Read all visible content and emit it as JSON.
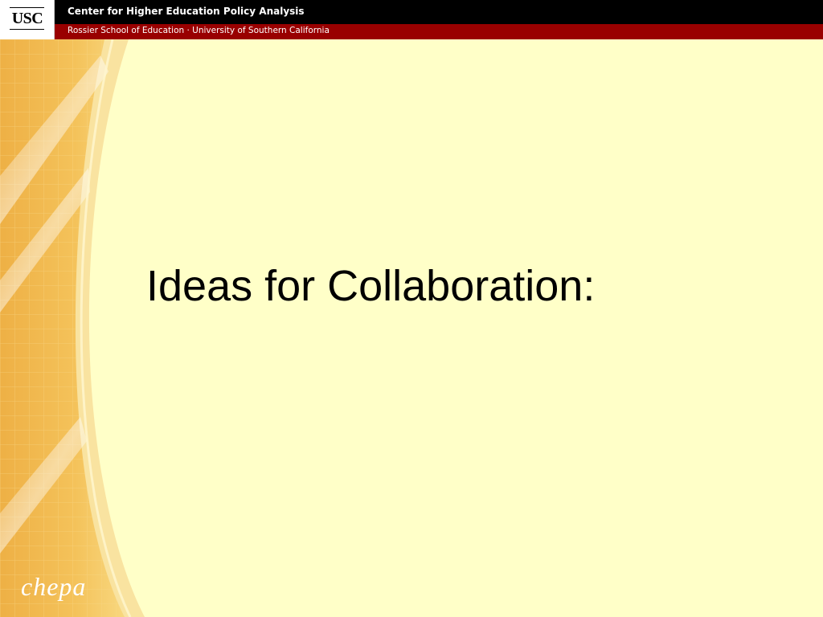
{
  "header": {
    "logo_text": "USC",
    "title": "Center for Higher Education Policy Analysis",
    "subtitle": "Rossier School of Education · University of Southern California"
  },
  "slide": {
    "title": "Ideas for Collaboration:"
  },
  "footer": {
    "brand": "chepa"
  },
  "colors": {
    "header_black": "#000000",
    "header_red": "#990000",
    "background": "#ffffc8",
    "panel_orange": "#f2b84a"
  }
}
